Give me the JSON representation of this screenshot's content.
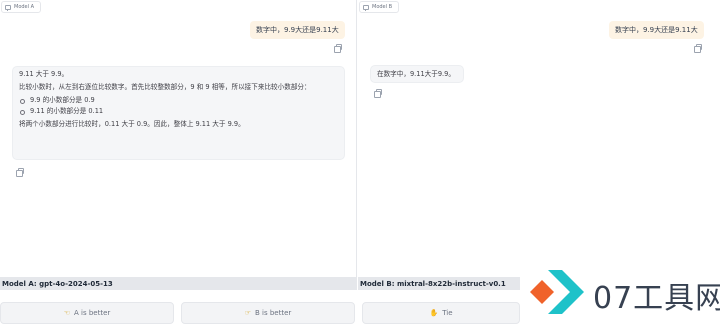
{
  "panel_a": {
    "header": "Model A",
    "user_message": "数字中，9.9大还是9.11大",
    "response": {
      "p1": "9.11 大于 9.9。",
      "p2": "比较小数时，从左到右逐位比较数字。首先比较整数部分，9 和 9 相等，所以接下来比较小数部分：",
      "bullets": [
        "9.9 的小数部分是 0.9",
        "9.11 的小数部分是 0.11"
      ],
      "p3": "将两个小数部分进行比较时，0.11 大于 0.9。因此，整体上 9.11 大于 9.9。"
    },
    "model_label": "Model A: gpt-4o-2024-05-13"
  },
  "panel_b": {
    "header": "Model B",
    "user_message": "数字中，9.9大还是9.11大",
    "response": "在数字中，9.11大于9.9。",
    "model_label": "Model B: mixtral-8x22b-instruct-v0.1"
  },
  "votes": {
    "a_better": "A is better",
    "b_better": "B is better",
    "tie": "Tie"
  },
  "icons": {
    "hand_a": "hand-pointing-left-icon",
    "hand_b": "hand-pointing-right-icon",
    "handshake": "handshake-icon",
    "copy": "copy-icon"
  },
  "watermark": {
    "text": "07工具网"
  },
  "colors": {
    "user_bubble": "#fdf3e4",
    "bot_bubble": "#f5f6f8",
    "label_bar": "#e5e7eb",
    "logo_orange": "#f0622a",
    "logo_teal": "#1ec2c9"
  }
}
